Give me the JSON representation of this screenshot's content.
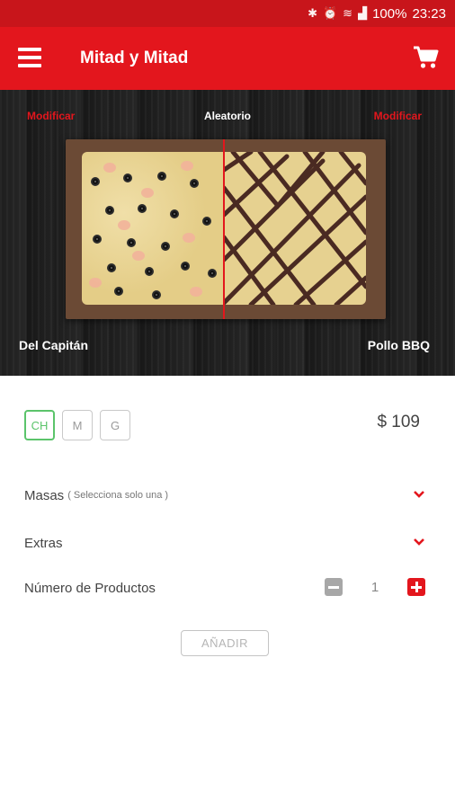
{
  "status_bar": {
    "battery": "100%",
    "time": "23:23",
    "icons": [
      "bluetooth-icon",
      "alarm-icon",
      "signal-icon",
      "wifi-icon"
    ]
  },
  "app_bar": {
    "title": "Mitad y Mitad",
    "menu_icon": "menu-icon",
    "cart_icon": "cart-icon"
  },
  "hero": {
    "left_link": "Modificar",
    "center_link": "Aleatorio",
    "right_link": "Modificar",
    "left_pizza": "Del Capitán",
    "right_pizza": "Pollo BBQ"
  },
  "sizes": {
    "options": [
      "CH",
      "M",
      "G"
    ],
    "selected": "CH"
  },
  "price": "$ 109",
  "options": {
    "masas_label": "Masas",
    "masas_hint": "( Selecciona solo una )",
    "extras_label": "Extras",
    "quantity_label": "Número de Productos",
    "quantity": "1"
  },
  "add_button": "AÑADIR",
  "colors": {
    "primary": "#e3161d",
    "status_bar": "#c8151b",
    "selected_size": "#5bc46b"
  }
}
